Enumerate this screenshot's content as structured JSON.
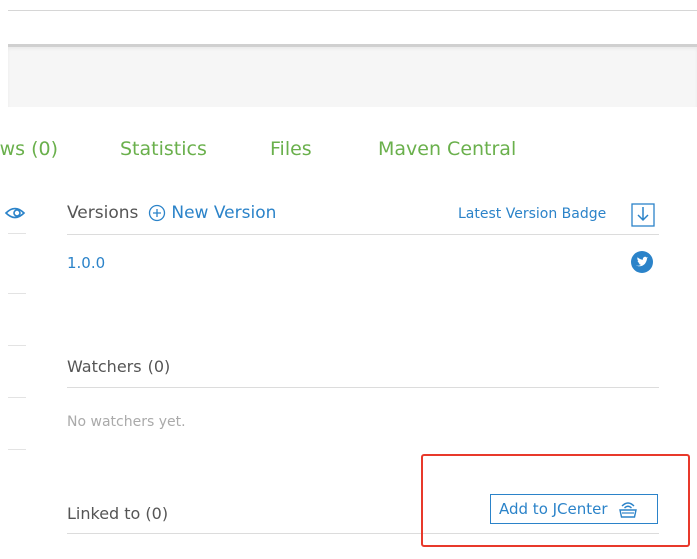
{
  "tabs": [
    {
      "label": "ws (0)"
    },
    {
      "label": "Statistics"
    },
    {
      "label": "Files"
    },
    {
      "label": "Maven Central"
    }
  ],
  "versions": {
    "title": "Versions",
    "new_version_label": "New Version",
    "badge_label": "Latest Version Badge",
    "items": [
      "1.0.0"
    ]
  },
  "watchers": {
    "title": "Watchers",
    "count": "(0)",
    "empty_text": "No watchers yet."
  },
  "linked": {
    "title": "Linked to (0)",
    "add_button_label": "Add to JCenter"
  },
  "colors": {
    "tab_green": "#6ab04c",
    "link_blue": "#2b83c9",
    "highlight_red": "#e8392b"
  },
  "icons": [
    "eye-icon",
    "plus-circle-icon",
    "download-icon",
    "twitter-icon",
    "jcenter-icon"
  ]
}
